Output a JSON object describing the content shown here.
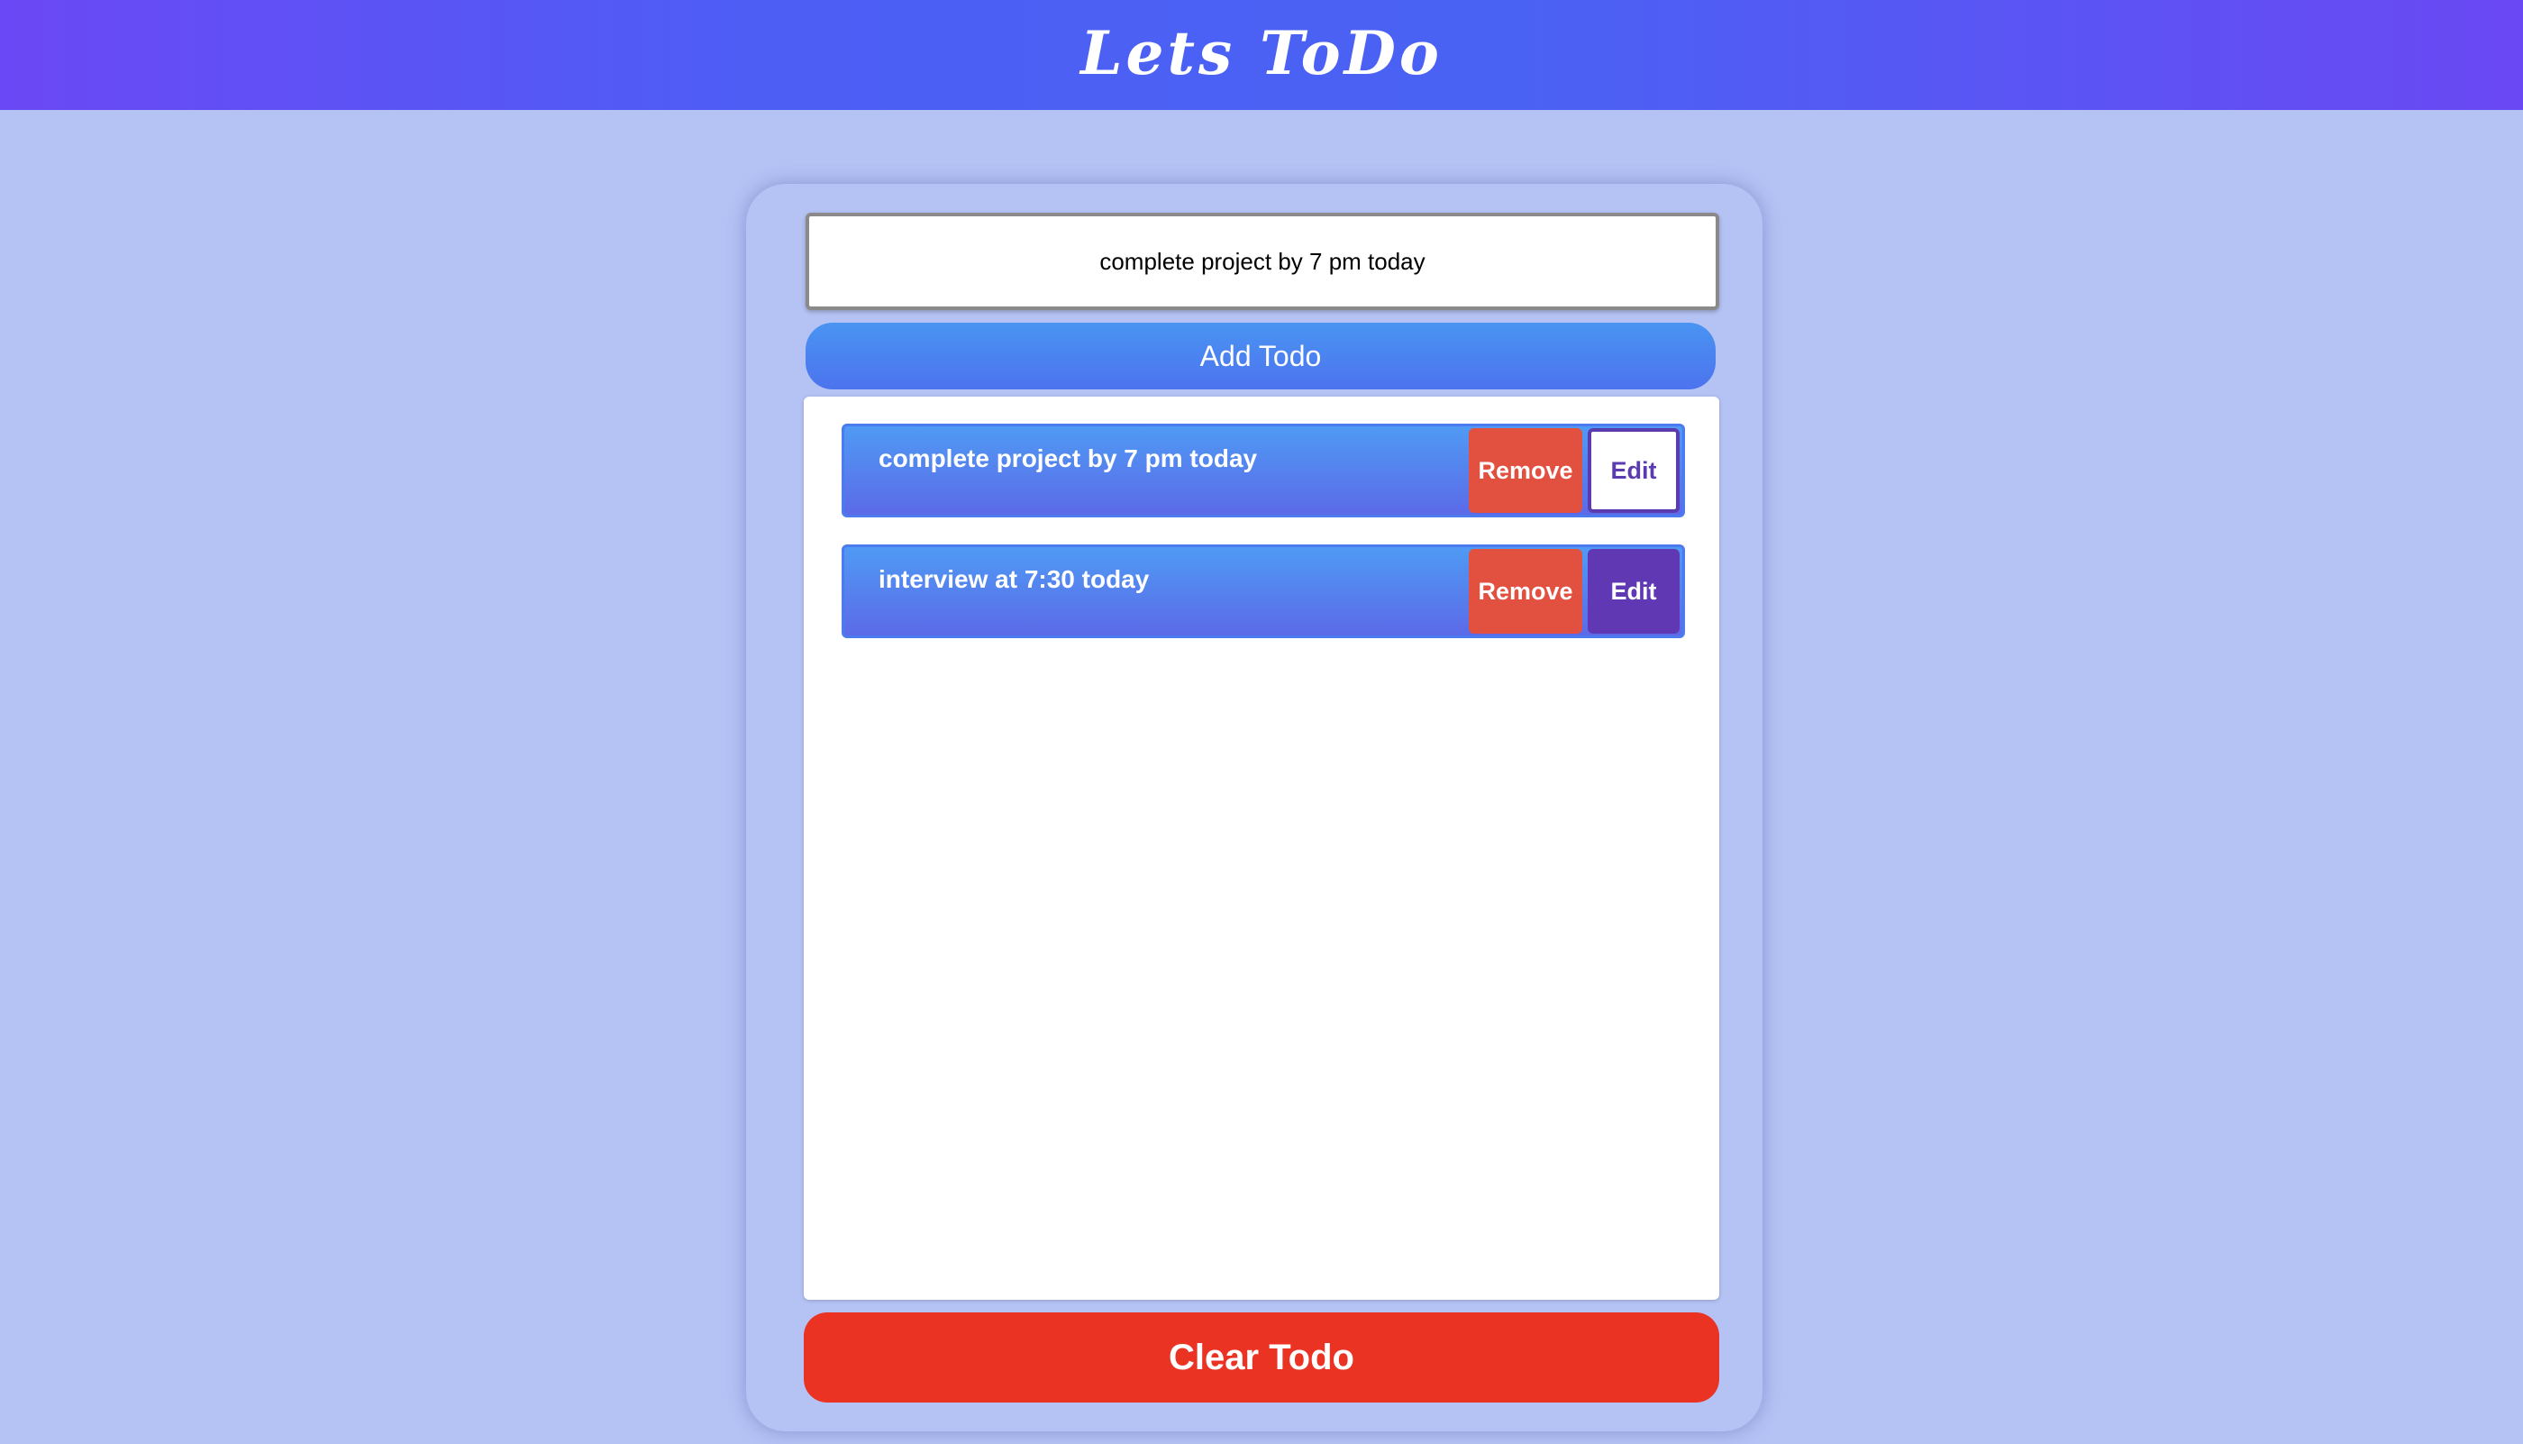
{
  "header": {
    "title": "Lets ToDo"
  },
  "input": {
    "value": "complete project by 7 pm today"
  },
  "add_button": {
    "label": "Add Todo"
  },
  "todos": [
    {
      "text": "complete project by 7 pm today",
      "remove_label": "Remove",
      "edit_label": "Edit"
    },
    {
      "text": "interview at 7:30 today",
      "remove_label": "Remove",
      "edit_label": "Edit"
    }
  ],
  "clear_button": {
    "label": "Clear Todo"
  },
  "colors": {
    "background": "#b5c2f4",
    "header_accent": "#4d5ef5",
    "remove": "#e25040",
    "edit": "#6038b3",
    "clear": "#ea3323"
  }
}
